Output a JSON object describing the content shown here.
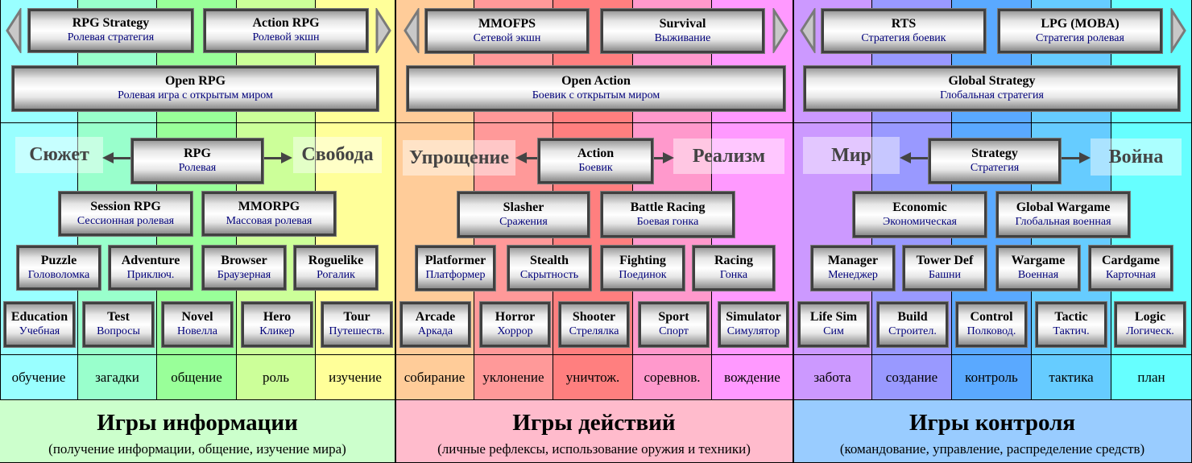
{
  "columns": [
    {
      "color": "#99ffff",
      "label": "обучение"
    },
    {
      "color": "#99ffcc",
      "label": "загадки"
    },
    {
      "color": "#99ff99",
      "label": "общение"
    },
    {
      "color": "#ccff99",
      "label": "роль"
    },
    {
      "color": "#ffff99",
      "label": "изучение"
    },
    {
      "color": "#ffcc99",
      "label": "собирание"
    },
    {
      "color": "#ff9999",
      "label": "уклонение"
    },
    {
      "color": "#ff7f7f",
      "label": "уничтож."
    },
    {
      "color": "#ff99cc",
      "label": "соревнов."
    },
    {
      "color": "#ff99ff",
      "label": "вождение"
    },
    {
      "color": "#cc99ff",
      "label": "забота"
    },
    {
      "color": "#9999ff",
      "label": "создание"
    },
    {
      "color": "#5aa9ff",
      "label": "контроль"
    },
    {
      "color": "#66ccff",
      "label": "тактика"
    },
    {
      "color": "#66ffff",
      "label": "план"
    }
  ],
  "groups": [
    {
      "title": "Игры информации",
      "subtitle": "(получение информации, общение, изучение мира)",
      "color": "#ccffcc"
    },
    {
      "title": "Игры действий",
      "subtitle": "(личные рефлексы, использование оружия и техники)",
      "color": "#ffbbcc"
    },
    {
      "title": "Игры контроля",
      "subtitle": "(командование, управление, распределение средств)",
      "color": "#99ccff"
    }
  ],
  "sections": [
    {
      "top": [
        {
          "en": "RPG Strategy",
          "ru": "Ролевая стратегия"
        },
        {
          "en": "Action RPG",
          "ru": "Ролевой экшн"
        }
      ],
      "open": {
        "en": "Open RPG",
        "ru": "Ролевая игра с открытым миром"
      },
      "root": {
        "en": "RPG",
        "ru": "Ролевая"
      },
      "axis_left": "Сюжет",
      "axis_right": "Свобода",
      "mid": [
        {
          "en": "Session RPG",
          "ru": "Сессионная ролевая"
        },
        {
          "en": "MMORPG",
          "ru": "Массовая ролевая"
        }
      ],
      "row4": [
        {
          "en": "Puzzle",
          "ru": "Головоломка"
        },
        {
          "en": "Adventure",
          "ru": "Приключ."
        },
        {
          "en": "Browser",
          "ru": "Браузерная"
        },
        {
          "en": "Roguelike",
          "ru": "Рогалик"
        }
      ],
      "row5": [
        {
          "en": "Education",
          "ru": "Учебная"
        },
        {
          "en": "Test",
          "ru": "Вопросы"
        },
        {
          "en": "Novel",
          "ru": "Новелла"
        },
        {
          "en": "Hero",
          "ru": "Кликер"
        },
        {
          "en": "Tour",
          "ru": "Путешеств."
        }
      ]
    },
    {
      "top": [
        {
          "en": "MMOFPS",
          "ru": "Сетевой экшн"
        },
        {
          "en": "Survival",
          "ru": "Выживание"
        }
      ],
      "open": {
        "en": "Open Action",
        "ru": "Боевик с открытым миром"
      },
      "root": {
        "en": "Action",
        "ru": "Боевик"
      },
      "axis_left": "Упрощение",
      "axis_right": "Реализм",
      "mid": [
        {
          "en": "Slasher",
          "ru": "Сражения"
        },
        {
          "en": "Battle Racing",
          "ru": "Боевая гонка"
        }
      ],
      "row4": [
        {
          "en": "Platformer",
          "ru": "Платформер"
        },
        {
          "en": "Stealth",
          "ru": "Скрытность"
        },
        {
          "en": "Fighting",
          "ru": "Поединок"
        },
        {
          "en": "Racing",
          "ru": "Гонка"
        }
      ],
      "row5": [
        {
          "en": "Arcade",
          "ru": "Аркада"
        },
        {
          "en": "Horror",
          "ru": "Хоррор"
        },
        {
          "en": "Shooter",
          "ru": "Стрелялка"
        },
        {
          "en": "Sport",
          "ru": "Спорт"
        },
        {
          "en": "Simulator",
          "ru": "Симулятор"
        }
      ]
    },
    {
      "top": [
        {
          "en": "RTS",
          "ru": "Стратегия боевик"
        },
        {
          "en": "LPG (MOBA)",
          "ru": "Стратегия ролевая"
        }
      ],
      "open": {
        "en": "Global Strategy",
        "ru": "Глобальная стратегия"
      },
      "root": {
        "en": "Strategy",
        "ru": "Стратегия"
      },
      "axis_left": "Мир",
      "axis_right": "Война",
      "mid": [
        {
          "en": "Economic",
          "ru": "Экономическая"
        },
        {
          "en": "Global Wargame",
          "ru": "Глобальная военная"
        }
      ],
      "row4": [
        {
          "en": "Manager",
          "ru": "Менеджер"
        },
        {
          "en": "Tower Def",
          "ru": "Башни"
        },
        {
          "en": "Wargame",
          "ru": "Военная"
        },
        {
          "en": "Cardgame",
          "ru": "Карточная"
        }
      ],
      "row5": [
        {
          "en": "Life Sim",
          "ru": "Сим"
        },
        {
          "en": "Build",
          "ru": "Строител."
        },
        {
          "en": "Control",
          "ru": "Полковод."
        },
        {
          "en": "Tactic",
          "ru": "Тактич."
        },
        {
          "en": "Logic",
          "ru": "Логическ."
        }
      ]
    }
  ]
}
